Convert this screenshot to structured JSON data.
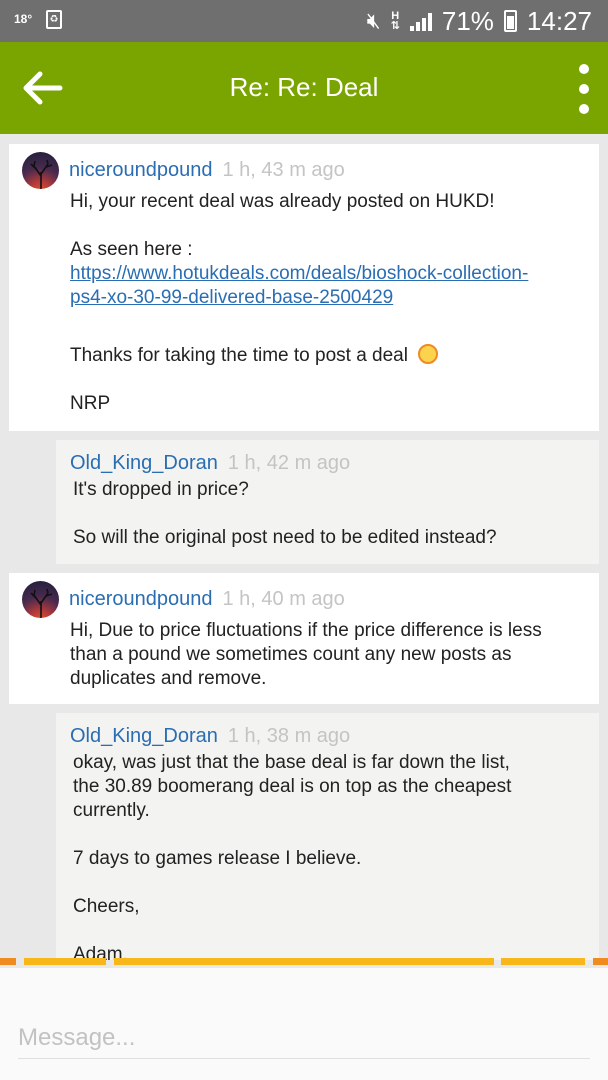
{
  "status_bar": {
    "temperature": "18°",
    "battery_percent": "71%",
    "time": "14:27",
    "network_label": "H",
    "icons": [
      "recycle-notification-icon",
      "mute-icon",
      "signal-icon",
      "battery-icon"
    ]
  },
  "app_bar": {
    "title": "Re: Re: Deal",
    "back_icon": "arrow-left-icon",
    "menu_icon": "more-vertical-icon",
    "color": "#7aa400"
  },
  "messages": [
    {
      "username": "niceroundpound",
      "time": "1 h, 43 m ago",
      "lines": [
        "Hi, your recent deal was already posted on HUKD!",
        "As seen here :",
        "https://www.hotukdeals.com/deals/bioshock-collection-",
        "ps4-xo-30-99-delivered-base-2500429",
        "Thanks for taking the time to post a deal",
        "NRP"
      ]
    },
    {
      "username": "Old_King_Doran",
      "time": "1 h, 42 m ago",
      "lines": [
        "It's dropped in price?",
        "So will the original post need to be edited instead?"
      ]
    },
    {
      "username": "niceroundpound",
      "time": "1 h, 40 m ago",
      "lines": [
        "Hi, Due to price fluctuations if the price difference is less",
        "than a pound we sometimes count any new posts as",
        "duplicates and remove."
      ]
    },
    {
      "username": "Old_King_Doran",
      "time": "1 h, 38 m ago",
      "lines": [
        "okay, was just that the base deal is far down the list,",
        "the 30.89 boomerang deal is on top as the cheapest",
        "currently.",
        "7 days to games release I believe.",
        "Cheers,",
        "Adam."
      ]
    }
  ],
  "composer": {
    "placeholder": "Message..."
  },
  "colors": {
    "username": "#2a6db3",
    "timestamp": "#c4c4c4",
    "progress": "#f7b719"
  }
}
